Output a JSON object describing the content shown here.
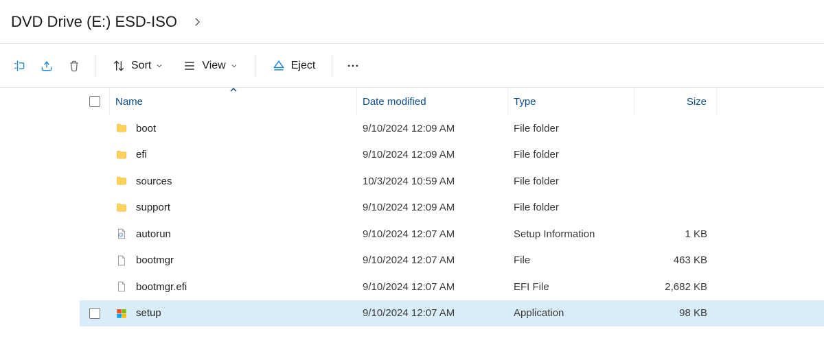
{
  "breadcrumb": {
    "title": "DVD Drive (E:) ESD-ISO"
  },
  "toolbar": {
    "sort_label": "Sort",
    "view_label": "View",
    "eject_label": "Eject"
  },
  "columns": {
    "name": "Name",
    "date": "Date modified",
    "type": "Type",
    "size": "Size"
  },
  "rows": [
    {
      "icon": "folder",
      "name": "boot",
      "date": "9/10/2024 12:09 AM",
      "type": "File folder",
      "size": ""
    },
    {
      "icon": "folder",
      "name": "efi",
      "date": "9/10/2024 12:09 AM",
      "type": "File folder",
      "size": ""
    },
    {
      "icon": "folder",
      "name": "sources",
      "date": "10/3/2024 10:59 AM",
      "type": "File folder",
      "size": ""
    },
    {
      "icon": "folder",
      "name": "support",
      "date": "9/10/2024 12:09 AM",
      "type": "File folder",
      "size": ""
    },
    {
      "icon": "inf",
      "name": "autorun",
      "date": "9/10/2024 12:07 AM",
      "type": "Setup Information",
      "size": "1 KB"
    },
    {
      "icon": "file",
      "name": "bootmgr",
      "date": "9/10/2024 12:07 AM",
      "type": "File",
      "size": "463 KB"
    },
    {
      "icon": "file",
      "name": "bootmgr.efi",
      "date": "9/10/2024 12:07 AM",
      "type": "EFI File",
      "size": "2,682 KB"
    },
    {
      "icon": "app",
      "name": "setup",
      "date": "9/10/2024 12:07 AM",
      "type": "Application",
      "size": "98 KB"
    }
  ],
  "selected_index": 7
}
